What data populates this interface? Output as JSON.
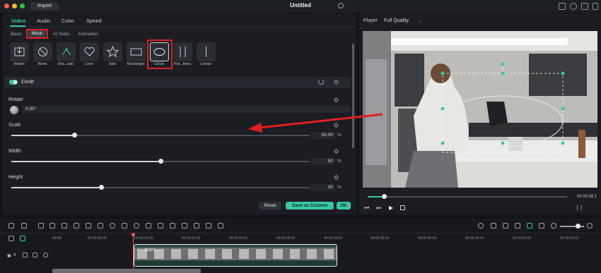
{
  "titlebar": {
    "import_label": "Import",
    "title": "Untitled"
  },
  "panel_tabs": [
    "Video",
    "Audio",
    "Color",
    "Speed"
  ],
  "sub_tabs": [
    "Basic",
    "Mask",
    "AI Tools",
    "Animation"
  ],
  "masks": [
    {
      "label": "Import",
      "icon": "import-icon"
    },
    {
      "label": "None",
      "icon": "none-icon"
    },
    {
      "label": "Dra...ask",
      "icon": "draw-mask-icon"
    },
    {
      "label": "Love",
      "icon": "heart-icon"
    },
    {
      "label": "Star",
      "icon": "star-icon"
    },
    {
      "label": "Rectangle",
      "icon": "rectangle-icon"
    },
    {
      "label": "Circle",
      "icon": "circle-icon"
    },
    {
      "label": "Par...lines",
      "icon": "parallel-lines-icon"
    },
    {
      "label": "Linear",
      "icon": "linear-icon"
    }
  ],
  "section": {
    "title": "Circle"
  },
  "rotate": {
    "label": "Rotate",
    "value": "0.00°"
  },
  "scale": {
    "label": "Scale",
    "value": "50.00",
    "unit": "%",
    "level": 0.21
  },
  "width": {
    "label": "Width",
    "value": "50",
    "unit": "%",
    "level": 0.5
  },
  "height": {
    "label": "Height",
    "value": "30",
    "unit": "%",
    "level": 0.3
  },
  "buttons": {
    "reset": "Reset",
    "save_custom": "Save as Custom",
    "ok": "OK"
  },
  "player": {
    "label": "Player",
    "quality": "Full Quality",
    "time": "00:00:08:1",
    "progress": 0.08
  },
  "timeline": {
    "ticks": [
      "00:00",
      "00:00:05:00",
      "00:00:10:00",
      "00:00:15:00",
      "00:00:20:01",
      "00:00:25:01",
      "00:00:30:01",
      "00:00:35:01",
      "00:00:40:01",
      "00:00:45:01",
      "00:00:50:02",
      "00:00:55:02"
    ],
    "track_number": "4",
    "clip_name": "15927..."
  },
  "colors": {
    "accent": "#38c6a6",
    "highlight": "#e02020",
    "panel": "#1b1d22"
  }
}
